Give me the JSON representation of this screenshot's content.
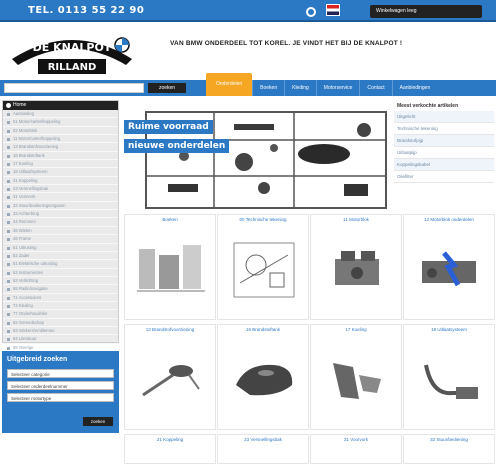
{
  "header": {
    "phone": "TEL. 0113 55 22 90",
    "shop_button": "Winkelwagen leeg",
    "icons": [
      "cart-icon",
      "flag-icon"
    ],
    "brand_color": "#2b78c4"
  },
  "logo": {
    "line1": "DE KNALPOT",
    "line2": "RILLAND"
  },
  "tagline": "VAN BMW ONDERDEEL TOT KOREL. JE VINDT HET BIJ DE KNALPOT !",
  "search": {
    "placeholder": "",
    "button": "zoeken"
  },
  "nav": {
    "items": [
      "Onderdelen",
      "Boeken",
      "Kleding",
      "Motorservice",
      "Contact",
      "Aanbiedingen"
    ]
  },
  "sidebar": {
    "title": "Home",
    "items": [
      "Aanbieding",
      "01 Motor/carter/koppeling",
      "02 Motorblok",
      "11 Motor/carter/koppeling",
      "13 Brandstofvoorziening",
      "16 Brandstoftank",
      "17 Koeling",
      "18 Uitlaat/systeem",
      "21 Koppeling",
      "23 Versnellingsbak",
      "31 Voorvork",
      "32 Stuur/bedieningsorganen",
      "33 Achterbrug",
      "34 Remmen",
      "36 Wielen",
      "46 Frame",
      "51 Uitrusting",
      "52 Zadel",
      "61 Elektrische uitrusting",
      "62 Instrumenten",
      "63 Verlichting",
      "65 Radio/navigatie",
      "71 Accessoires",
      "72 Kleding",
      "77 Onderhoud/olie",
      "82 Gereedschap",
      "83 Stickers/emblemen",
      "84 Literatuur",
      "85 Overige",
      "91 Restanten"
    ]
  },
  "filter": {
    "title": "Uitgebreid zoeken",
    "selects": [
      "Selecteer categorie",
      "Selecteer onderdeelnummer",
      "Selecteer motortype"
    ],
    "button": "zoeken"
  },
  "hero": {
    "line1": "Ruime voorraad",
    "line2": "nieuwe onderdelen"
  },
  "rightcol": {
    "title": "Meest verkochte artikelen",
    "items": [
      "Uitgelicht",
      "Technische tekening",
      "Brandstofpijp",
      "Uitlaatpijp",
      "Koppelingskabel",
      "Oliefilter"
    ]
  },
  "tiles": [
    "Boeken",
    "00 Technische tekening",
    "11 Motorblok",
    "12 Motorblok onderdelen",
    "13 Brandstofvoorziening",
    "16 Brandstoftank",
    "17 Koeling",
    "18 Uitlaatsysteem",
    "21 Koppeling",
    "23 Versnellingsbak",
    "31 Voorvork",
    "32 Stuur/bediening"
  ]
}
